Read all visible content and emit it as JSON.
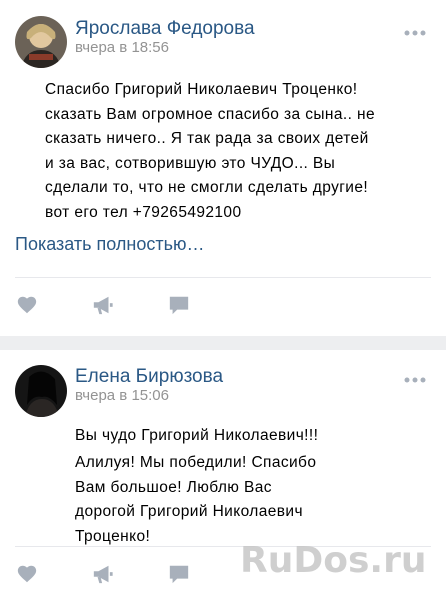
{
  "posts": [
    {
      "author": "Ярослава Федорова",
      "time": "вчера в 18:56",
      "lines": [
        "Спасибо Григорий Николаевич Троценко!",
        "сказать Вам огромное спасибо за сына.. не",
        "сказать ничего.. Я так рада за своих детей",
        "и за вас, сотворившую это ЧУДО... Вы",
        "сделали то, что не смогли сделать другие!",
        "вот его тел +79265492100"
      ],
      "show_more": "Показать полностью…"
    },
    {
      "author": "Елена Бирюзова",
      "time": "вчера в 15:06",
      "paragraph1": "Вы чудо Григорий Николаевич!!!",
      "lines": [
        "Алилуя! Мы победили! Спасибо",
        "Вам большое! Люблю Вас",
        "дорогой Григорий Николаевич",
        "Троценко!"
      ]
    }
  ],
  "icons": {
    "like": "heart-icon",
    "share": "megaphone-icon",
    "comment": "comment-icon",
    "more": "more-dots-icon"
  },
  "colors": {
    "author": "#2a5885",
    "time": "#939393",
    "icon": "#a8b0bb",
    "background": "#edeef0"
  },
  "watermark": "RuDos.ru"
}
